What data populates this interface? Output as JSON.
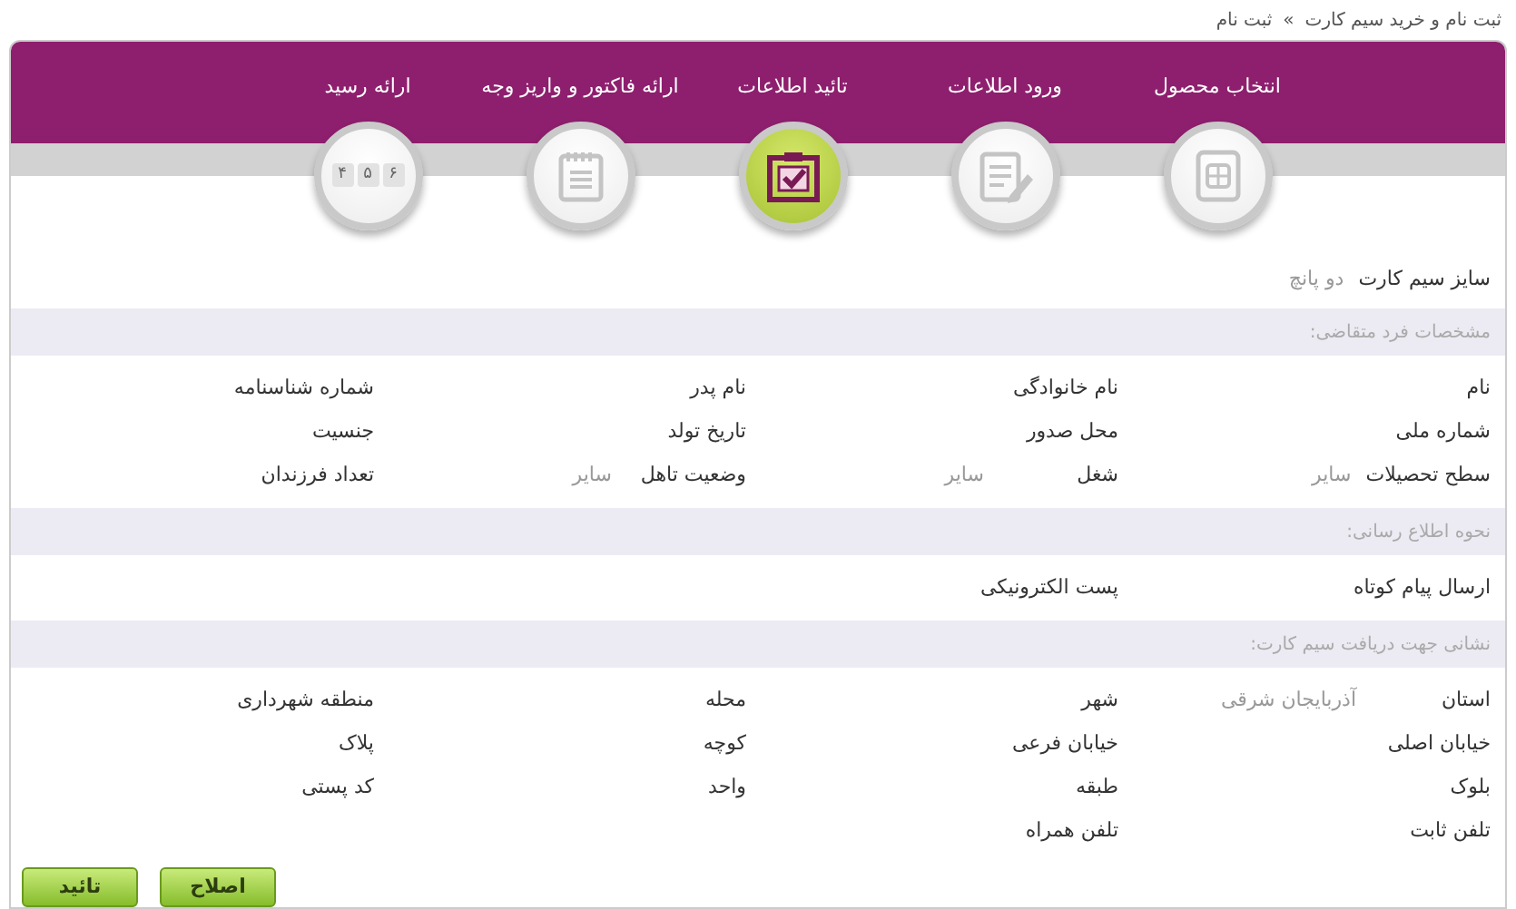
{
  "breadcrumb": {
    "items": [
      "ثبت نام و خرید سیم کارت",
      "ثبت نام"
    ],
    "separator": "»"
  },
  "steps": [
    {
      "label": "انتخاب محصول",
      "kind": "sim",
      "selected": false
    },
    {
      "label": "ورود اطلاعات",
      "kind": "form",
      "selected": false
    },
    {
      "label": "تائید اطلاعات",
      "kind": "check",
      "selected": true
    },
    {
      "label": "ارائه فاکتور و واریز وجه",
      "kind": "notepad",
      "selected": false
    },
    {
      "label": "ارائه رسید",
      "kind": "receipt",
      "icon_text": [
        "۶",
        "۵",
        "۴"
      ],
      "selected": false
    }
  ],
  "sim_size": {
    "label": "سایز سیم کارت",
    "value": "دو پانچ"
  },
  "sections": [
    {
      "title": "مشخصات فرد متقاضی:",
      "rows": [
        [
          {
            "label": "نام"
          },
          {
            "label": "نام خانوادگی"
          },
          {
            "label": "نام پدر"
          },
          {
            "label": "شماره شناسنامه"
          }
        ],
        [
          {
            "label": "شماره ملی"
          },
          {
            "label": "محل صدور"
          },
          {
            "label": "تاریخ تولد"
          },
          {
            "label": "جنسیت"
          }
        ],
        [
          {
            "label": "سطح تحصیلات",
            "value": "سایر"
          },
          {
            "label": "شغل",
            "value": "سایر"
          },
          {
            "label": "وضعیت تاهل",
            "value": "سایر"
          },
          {
            "label": "تعداد فرزندان"
          }
        ]
      ]
    },
    {
      "title": "نحوه اطلاع رسانی:",
      "rows": [
        [
          {
            "label": "ارسال پیام کوتاه"
          },
          {
            "label": "پست الکترونیکی"
          }
        ]
      ]
    },
    {
      "title": "نشانی جهت دریافت سیم کارت:",
      "rows": [
        [
          {
            "label": "استان",
            "value": "آذربایجان شرقی"
          },
          {
            "label": "شهر"
          },
          {
            "label": "محله"
          },
          {
            "label": "منطقه شهرداری"
          }
        ],
        [
          {
            "label": "خیابان اصلی"
          },
          {
            "label": "خیابان فرعی"
          },
          {
            "label": "کوچه"
          },
          {
            "label": "پلاک"
          }
        ],
        [
          {
            "label": "بلوک"
          },
          {
            "label": "طبقه"
          },
          {
            "label": "واحد"
          },
          {
            "label": "کد پستی"
          }
        ],
        [
          {
            "label": "تلفن ثابت"
          },
          {
            "label": "تلفن همراه"
          }
        ]
      ]
    }
  ],
  "buttons": [
    {
      "label": "اصلاح"
    },
    {
      "label": "تائید"
    }
  ]
}
